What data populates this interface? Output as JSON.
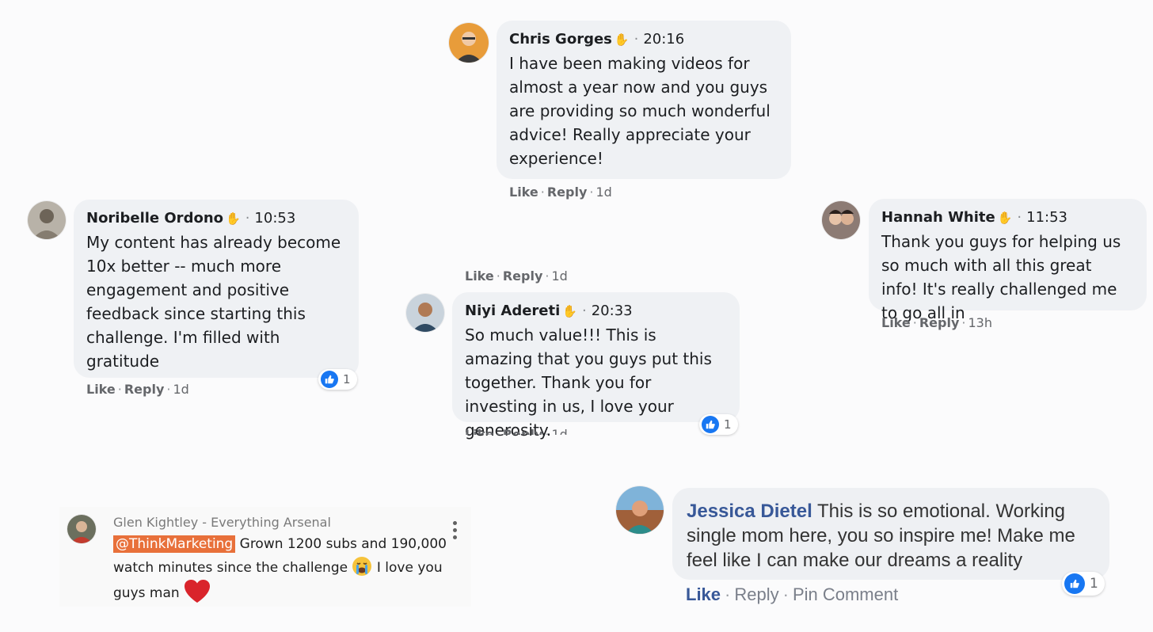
{
  "comments": [
    {
      "name": "Chris Gorges",
      "time": "20:16",
      "text": "I have been making videos for almost a year now and you guys are providing so much wonderful advice! Really appreciate your experience!",
      "like": "Like",
      "reply": "Reply",
      "age": "1d",
      "avatar_color": "#e89c3a"
    },
    {
      "name": "Noribelle Ordono",
      "time": "10:53",
      "text": "My content has already become 10x better -- much more engagement and positive feedback since starting this challenge. I'm filled with gratitude",
      "like": "Like",
      "reply": "Reply",
      "age": "1d",
      "reactions": "1",
      "avatar_color": "#8a8478"
    },
    {
      "name": "Niyi Adereti",
      "time": "20:33",
      "text": "So much value!!! This is amazing that you guys put this together. Thank you for investing in us, I love your generosity.",
      "above_like": "Like",
      "above_reply": "Reply",
      "above_age": "1d",
      "like": "Like",
      "reply": "Reply",
      "age": "1d",
      "reactions": "1",
      "avatar_color": "#c9d3dc"
    },
    {
      "name": "Hannah White",
      "time": "11:53",
      "text": "Thank you guys for helping us so much with all this great info! It's really challenged me to go all in",
      "like": "Like",
      "reply": "Reply",
      "age": "13h",
      "avatar_color": "#5a4e4a"
    }
  ],
  "youtube": {
    "author": "Glen Kightley - Everything Arsenal",
    "mention": "@ThinkMarketing",
    "text_before_emoji": "Grown 1200 subs and 190,000 watch minutes since the challenge",
    "text_after_emoji": "I love you guys man"
  },
  "jessica": {
    "name": "Jessica Dietel",
    "text": "This is so emotional. Working single mom here, you so inspire me! Make me feel like I can make our dreams a reality",
    "like": "Like",
    "reply": "Reply",
    "pin": "Pin Comment",
    "reactions": "1"
  },
  "colors": {
    "facebook_blue": "#1877f2",
    "name_blue": "#385898",
    "mention_orange": "#e8703a",
    "bubble_grey": "#eff1f4"
  },
  "icons": [
    "wave-icon",
    "like-reaction-icon",
    "kebab-menu-icon",
    "crying-emoji-icon",
    "heart-icon"
  ]
}
